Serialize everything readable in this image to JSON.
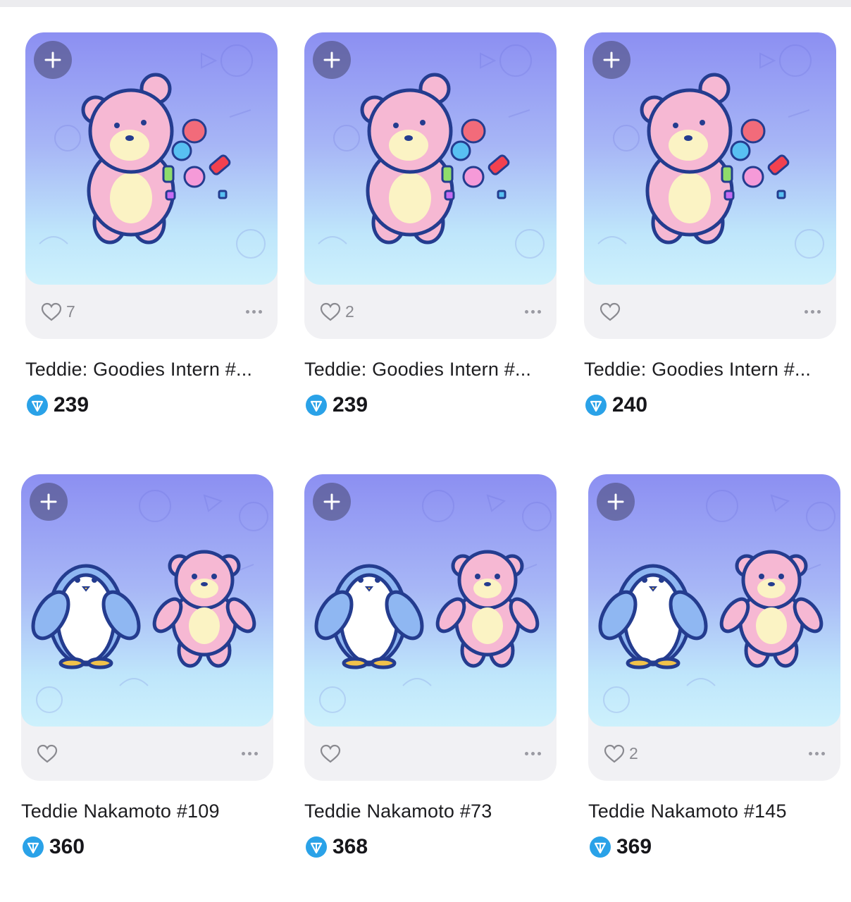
{
  "colors": {
    "ton": "#2aa2e8",
    "bear_pink": "#f6b8d3",
    "bear_belly": "#fbf3c4",
    "outline": "#243c8f",
    "penguin_blue": "#8fb7f2"
  },
  "cards": [
    {
      "like_count": "7",
      "title": "Teddie: Goodies Intern #...",
      "price": "239",
      "art": "bear-with-candies"
    },
    {
      "like_count": "2",
      "title": "Teddie: Goodies Intern #...",
      "price": "239",
      "art": "bear-with-candies"
    },
    {
      "like_count": "",
      "title": "Teddie: Goodies Intern #...",
      "price": "240",
      "art": "bear-with-candies"
    },
    {
      "like_count": "",
      "title": "Teddie Nakamoto #109",
      "price": "360",
      "art": "penguin-and-bear"
    },
    {
      "like_count": "",
      "title": "Teddie Nakamoto #73",
      "price": "368",
      "art": "penguin-and-bear"
    },
    {
      "like_count": "2",
      "title": "Teddie Nakamoto #145",
      "price": "369",
      "art": "penguin-and-bear"
    }
  ],
  "icons": {
    "add": "plus-icon",
    "like": "heart-icon",
    "more": "more-dots-icon",
    "currency": "ton-diamond-icon"
  }
}
